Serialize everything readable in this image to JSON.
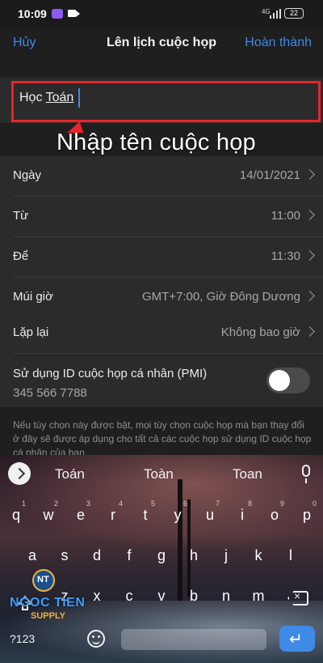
{
  "status_bar": {
    "time": "10:09",
    "sim_label": "4G",
    "battery": "22"
  },
  "header": {
    "cancel": "Hủy",
    "title": "Lên lịch cuộc họp",
    "done": "Hoàn thành"
  },
  "meeting_name": {
    "word1": "Học",
    "word2": "Toán"
  },
  "callout": {
    "text": "Nhập tên cuộc họp"
  },
  "rows": [
    {
      "label": "Ngày",
      "value": "14/01/2021"
    },
    {
      "label": "Từ",
      "value": "11:00"
    },
    {
      "label": "Để",
      "value": "11:30"
    },
    {
      "label": "Múi giờ",
      "value": "GMT+7:00, Giờ Đông Dương"
    },
    {
      "label": "Lặp lại",
      "value": "Không bao giờ"
    }
  ],
  "pmi": {
    "label": "Sử dụng ID cuộc họp cá nhân (PMI)",
    "id": "345 566 7788",
    "enabled": false
  },
  "note": "Nếu tùy chọn này được bật, mọi tùy chọn cuộc họp mà bạn thay đổi ở đây sẽ được áp dụng cho tất cả các cuộc họp sử dụng ID cuộc họp cá nhân của bạn.",
  "keyboard": {
    "suggestions": [
      "Toán",
      "Toàn",
      "Toan"
    ],
    "row1": [
      "q",
      "w",
      "e",
      "r",
      "t",
      "y",
      "u",
      "i",
      "o",
      "p"
    ],
    "row1_hints": [
      "1",
      "2",
      "3",
      "4",
      "5",
      "6",
      "7",
      "8",
      "9",
      "0"
    ],
    "row2": [
      "a",
      "s",
      "d",
      "f",
      "g",
      "h",
      "j",
      "k",
      "l"
    ],
    "row3": [
      "z",
      "x",
      "c",
      "v",
      "b",
      "n",
      "m"
    ],
    "symbols_key": "?123"
  },
  "watermark": {
    "initials": "NT",
    "name": "NGOC TIEN",
    "sub": "SUPPLY"
  },
  "colors": {
    "accent": "#3f8ae6",
    "callout_red": "#e8242a",
    "background": "#1f1f1f",
    "row_bg": "#2b2b2b"
  }
}
